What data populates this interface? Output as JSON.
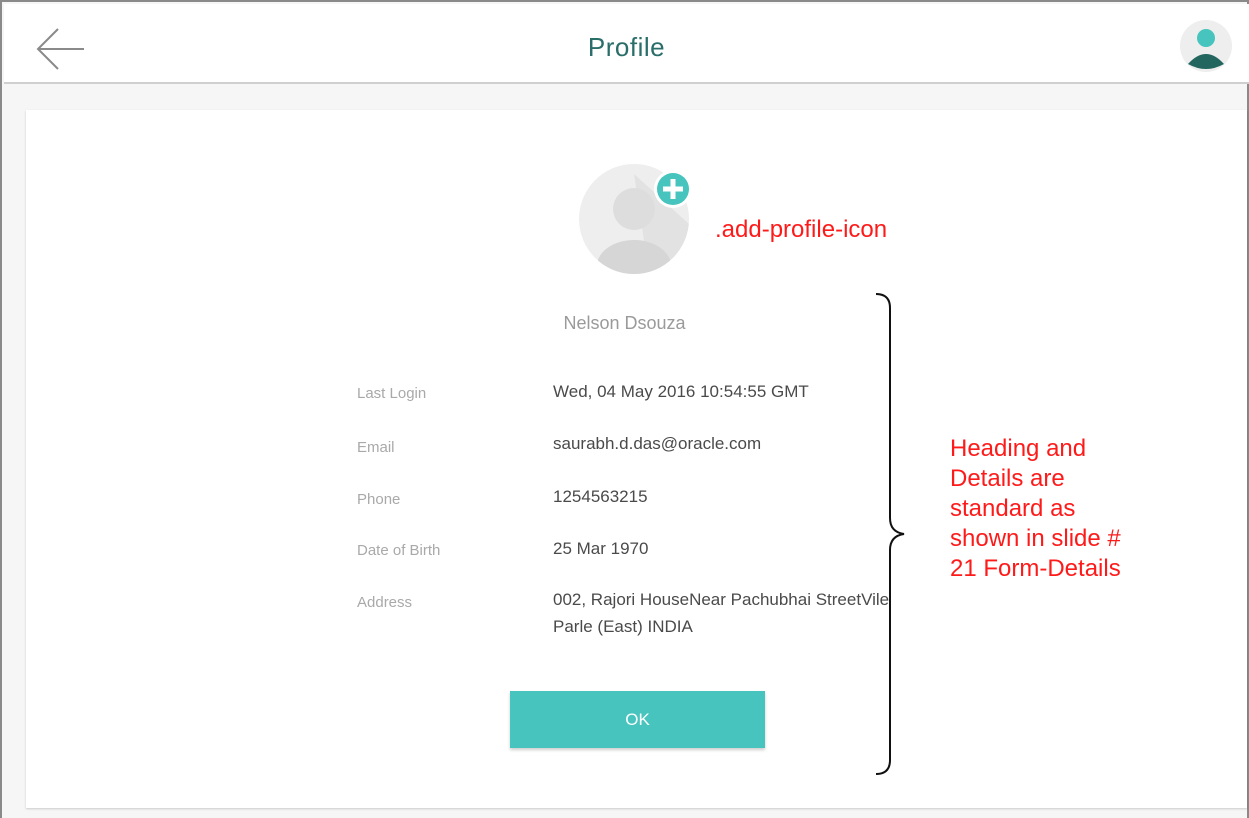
{
  "header": {
    "title": "Profile"
  },
  "profile": {
    "name": "Nelson Dsouza",
    "details": [
      {
        "label": "Last Login",
        "value": "Wed, 04 May 2016 10:54:55 GMT"
      },
      {
        "label": "Email",
        "value": "saurabh.d.das@oracle.com"
      },
      {
        "label": "Phone",
        "value": "1254563215"
      },
      {
        "label": "Date of Birth",
        "value": "25 Mar 1970"
      },
      {
        "label": "Address",
        "value": "002, Rajori HouseNear Pachubhai StreetVile Parle (East) INDIA"
      }
    ]
  },
  "actions": {
    "ok_label": "OK"
  },
  "annotations": {
    "icon_note": ".add-profile-icon",
    "heading_note": "Heading and Details are standard as shown in slide # 21 Form-Details"
  },
  "colors": {
    "accent": "#47c4bd",
    "title": "#2a6e6a",
    "annotation": "#ff1a1a"
  },
  "icons": {
    "back": "arrow-left-icon",
    "user": "user-avatar-icon",
    "add": "plus-circle-icon",
    "photo": "profile-placeholder-icon"
  }
}
